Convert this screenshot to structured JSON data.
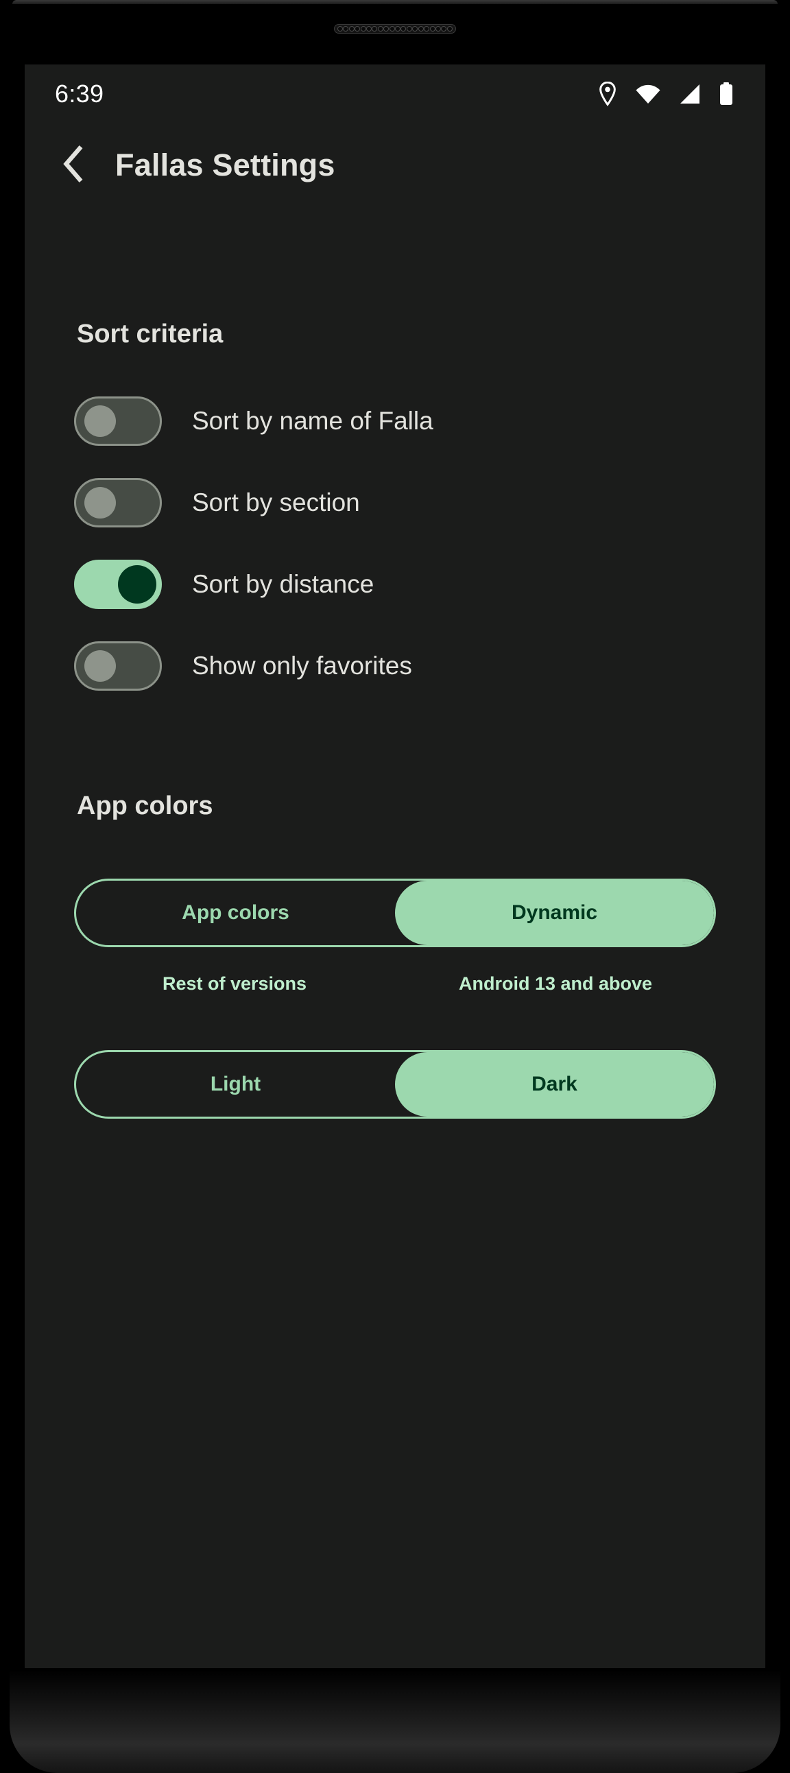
{
  "statusbar": {
    "time": "6:39",
    "icons": [
      {
        "name": "location-pin-icon"
      },
      {
        "name": "wifi-icon"
      },
      {
        "name": "cellular-signal-icon"
      },
      {
        "name": "battery-icon"
      }
    ]
  },
  "appbar": {
    "back_icon": "chevron-left-icon",
    "title": "Fallas Settings"
  },
  "sort_section": {
    "heading": "Sort criteria",
    "items": [
      {
        "label": "Sort by name of Falla",
        "state": "off"
      },
      {
        "label": "Sort by section",
        "state": "off"
      },
      {
        "label": "Sort by distance",
        "state": "on"
      },
      {
        "label": "Show only favorites",
        "state": "off"
      }
    ]
  },
  "colors_section": {
    "heading": "App colors",
    "palette_toggle": {
      "left": {
        "label": "App colors",
        "selected": false
      },
      "right": {
        "label": "Dynamic",
        "selected": true
      }
    },
    "captions": {
      "left": "Rest of versions",
      "right": "Android 13 and above"
    },
    "theme_toggle": {
      "left": {
        "label": "Light",
        "selected": false
      },
      "right": {
        "label": "Dark",
        "selected": true
      }
    }
  },
  "colors": {
    "screen_bg": "#1b1c1b",
    "accent_green": "#9cd8ae",
    "on_accent_text": "#00381f",
    "caption_green": "#bfeecd",
    "text_primary": "#e3e3de",
    "switch_off_track": "#464c45",
    "switch_off_thumb": "#8e948b",
    "switch_off_border": "#8c9289"
  },
  "navbar": {
    "gesture_pill": "home-gesture-pill"
  }
}
